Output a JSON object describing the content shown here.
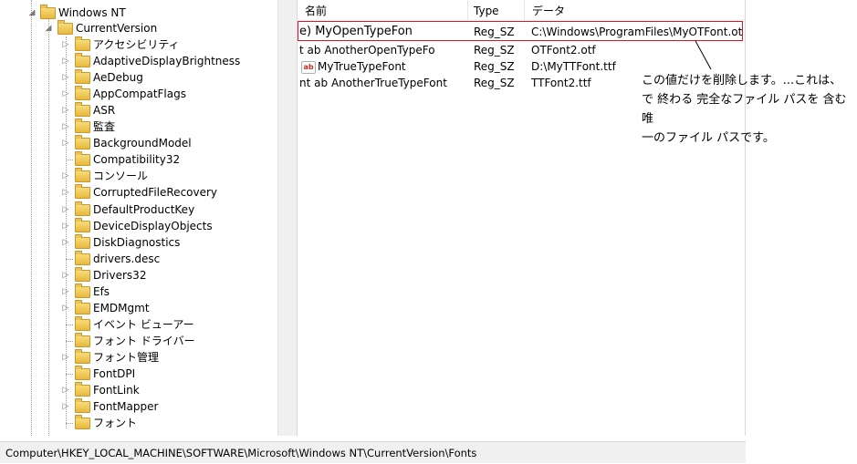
{
  "tree": {
    "root_label": "Windows NT",
    "current_label": "CurrentVersion",
    "children": [
      {
        "label": "アクセシビリティ",
        "expandable": true
      },
      {
        "label": "AdaptiveDisplayBrightness",
        "expandable": true
      },
      {
        "label": "AeDebug",
        "expandable": true
      },
      {
        "label": "AppCompatFlags",
        "expandable": true
      },
      {
        "label": "ASR",
        "expandable": true
      },
      {
        "label": "監査",
        "expandable": true
      },
      {
        "label": "BackgroundModel",
        "expandable": true
      },
      {
        "label": "Compatibility32",
        "expandable": false
      },
      {
        "label": "コンソール",
        "expandable": true
      },
      {
        "label": "CorruptedFileRecovery",
        "expandable": true
      },
      {
        "label": "DefaultProductKey",
        "expandable": true
      },
      {
        "label": "DeviceDisplayObjects",
        "expandable": true
      },
      {
        "label": "DiskDiagnostics",
        "expandable": true
      },
      {
        "label": "drivers.desc",
        "expandable": false
      },
      {
        "label": "Drivers32",
        "expandable": true
      },
      {
        "label": "Efs",
        "expandable": true
      },
      {
        "label": "EMDMgmt",
        "expandable": true
      },
      {
        "label": "イベント ビューアー",
        "expandable": false
      },
      {
        "label": "フォント ドライバー",
        "expandable": false
      },
      {
        "label": "フォント管理",
        "expandable": true
      },
      {
        "label": "FontDPI",
        "expandable": false
      },
      {
        "label": "FontLink",
        "expandable": true
      },
      {
        "label": "FontMapper",
        "expandable": true
      },
      {
        "label": "フォント",
        "expandable": false
      }
    ]
  },
  "list": {
    "headers": {
      "name": "名前",
      "type": "Type",
      "data": "データ"
    },
    "rows": [
      {
        "prefix": "e)",
        "name": "MyOpenTypeFon",
        "type": "Reg_SZ",
        "data": "C:\\Windows\\ProgramFiles\\MyOTFont.otf"
      },
      {
        "prefix": "t ab",
        "name": "AnotherOpenTypeFo",
        "type": "Reg_SZ",
        "data": "OTFont2.otf"
      },
      {
        "prefix": "ab",
        "name": "MyTrueTypeFont",
        "type": "Reg_SZ",
        "data": "D:\\MyTTFont.ttf"
      },
      {
        "prefix": "nt ab",
        "name": "AnotherTrueTypeFont",
        "type": "Reg_SZ",
        "data": "TTFont2.ttf"
      }
    ]
  },
  "callout": {
    "line1": "この値だけを削除します。...これは、",
    "line2": "で 終わる 完全なファイル パスを 含む 唯",
    "line3": "一のファイル パスです。",
    "color": "#e81123"
  },
  "statusbar": {
    "path": "Computer\\HKEY_LOCAL_MACHINE\\SOFTWARE\\Microsoft\\Windows NT\\CurrentVersion\\Fonts"
  }
}
